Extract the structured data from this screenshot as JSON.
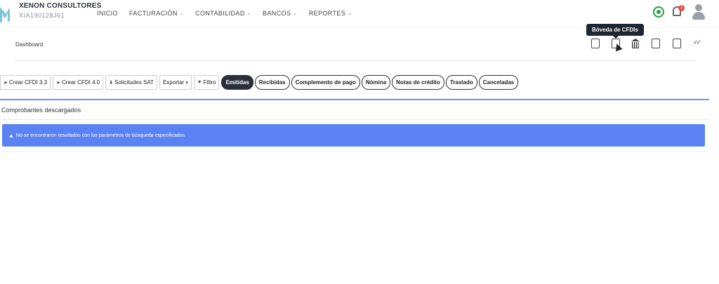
{
  "company": {
    "name": "XENON CONSULTORES",
    "rfc": "XIA190128J61"
  },
  "nav": {
    "items": [
      {
        "label": "INICIO",
        "has_dropdown": false
      },
      {
        "label": "FACTURACIÓN",
        "has_dropdown": true
      },
      {
        "label": "CONTABILIDAD",
        "has_dropdown": true
      },
      {
        "label": "BANCOS",
        "has_dropdown": true
      },
      {
        "label": "REPORTES",
        "has_dropdown": true
      }
    ],
    "notification_count": "1",
    "icons": [
      "whatsapp-icon",
      "bell-icon",
      "user-avatar-icon"
    ]
  },
  "breadcrumb": "Dashboard",
  "tooltip": "Bóveda de CFDIs",
  "toolbar": {
    "crear33": "Crear CFDI 3.3",
    "crear40": "Crear CFDI 4.0",
    "solicitudes": "Solicitudes SAT",
    "exportar": "Exportar",
    "filtro": "Filtro"
  },
  "tabs": [
    {
      "label": "Emitidas",
      "active": true
    },
    {
      "label": "Recibidas",
      "active": false
    },
    {
      "label": "Complemento de pago",
      "active": false
    },
    {
      "label": "Nómina",
      "active": false
    },
    {
      "label": "Notas de crédito",
      "active": false
    },
    {
      "label": "Traslado",
      "active": false
    },
    {
      "label": "Canceladas",
      "active": false
    }
  ],
  "card": {
    "title": "Comprobantes descargados",
    "alert": "No se encontraron resultados con los parámetros de búsqueda especificados"
  },
  "colors": {
    "accent": "#5b82f2",
    "active_tab": "#2a2f3a",
    "card_border": "#6f8ef5"
  }
}
